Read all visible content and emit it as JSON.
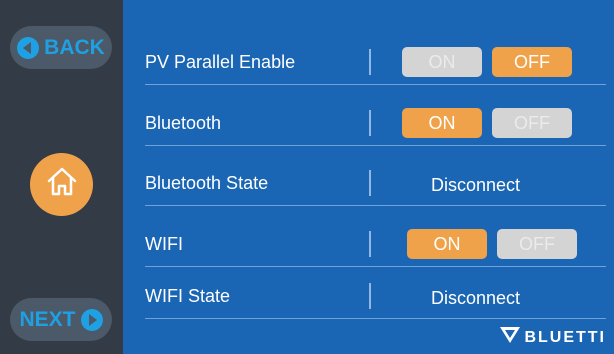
{
  "nav": {
    "back_label": "BACK",
    "next_label": "NEXT"
  },
  "settings": [
    {
      "label": "PV Parallel Enable",
      "type": "toggle",
      "on_label": "ON",
      "off_label": "OFF",
      "value": "OFF"
    },
    {
      "label": "Bluetooth",
      "type": "toggle",
      "on_label": "ON",
      "off_label": "OFF",
      "value": "ON"
    },
    {
      "label": "Bluetooth State",
      "type": "status",
      "value": "Disconnect"
    },
    {
      "label": "WIFI",
      "type": "toggle",
      "on_label": "ON",
      "off_label": "OFF",
      "value": "ON"
    },
    {
      "label": "WIFI State",
      "type": "status",
      "value": "Disconnect"
    }
  ],
  "brand": {
    "name": "BLUETTI"
  },
  "colors": {
    "background": "#1a66b4",
    "sidebar": "#323b46",
    "accent": "#f0a24a",
    "inactive": "#d4d4d4",
    "nav_text": "#1fa0e3"
  }
}
